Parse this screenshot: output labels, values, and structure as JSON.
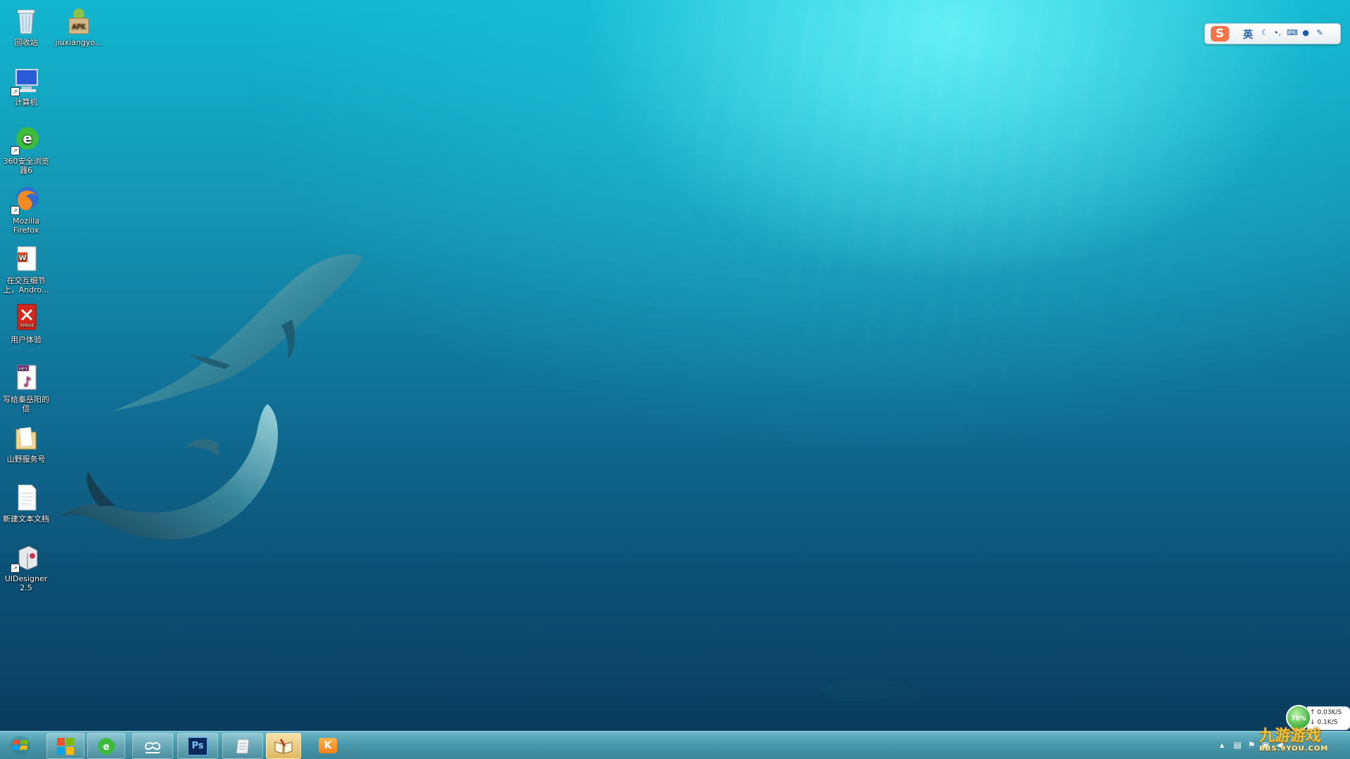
{
  "desktop": {
    "icons": [
      {
        "label": "回收站",
        "icon": "recycle-bin-icon"
      },
      {
        "label": "jiuxiangyo...",
        "icon": "apk-file-icon"
      },
      {
        "label": "计算机",
        "icon": "computer-icon"
      },
      {
        "label": "360安全浏览器6",
        "icon": "360-browser-icon"
      },
      {
        "label": "Mozilla Firefox",
        "icon": "firefox-icon"
      },
      {
        "label": "在交互细节上，Andro...",
        "icon": "document-icon"
      },
      {
        "label": "用户体验",
        "icon": "xmind-icon"
      },
      {
        "label": "写给秦岳阳的信",
        "icon": "mp3-icon"
      },
      {
        "label": "山野服务号",
        "icon": "folder-icon"
      },
      {
        "label": "新建文本文档",
        "icon": "text-file-icon"
      },
      {
        "label": "UIDesigner 2.5",
        "icon": "uidesigner-icon"
      }
    ],
    "apk_badge": "APK",
    "xmind_badge": "XMind",
    "mp3_badge": "MP3"
  },
  "ime": {
    "logo": "S",
    "mode": "英",
    "icons": [
      "moon-icon",
      "punctuation-icon",
      "keyboard-icon",
      "user-icon",
      "wrench-icon"
    ]
  },
  "taskbar": {
    "start": "start-button",
    "items": [
      {
        "name": "windows-explorer",
        "state": "pinned"
      },
      {
        "name": "360-browser",
        "state": "pinned"
      },
      {
        "name": "cloud-sync",
        "state": "pinned"
      },
      {
        "name": "photoshop",
        "label": "Ps",
        "state": "pinned"
      },
      {
        "name": "notepad",
        "state": "pinned"
      },
      {
        "name": "reader",
        "state": "active"
      },
      {
        "name": "kk-app",
        "label": "K",
        "state": "normal"
      }
    ],
    "tray_icons": [
      "show-hidden-icon",
      "window-icon",
      "flag-icon",
      "network-icon",
      "volume-icon"
    ]
  },
  "network_widget": {
    "percent": "70%",
    "up": "0.03K/S",
    "down": "0.1K/S"
  },
  "watermark": {
    "title": "九游游戏",
    "url": "BBS.9YOU.COM"
  },
  "colors": {
    "taskbar": "#4a98ab",
    "water_top": "#12b6cf",
    "water_bottom": "#0a3c5e",
    "ime_accent": "#1b5aa8",
    "active_item": "#e1b862"
  }
}
